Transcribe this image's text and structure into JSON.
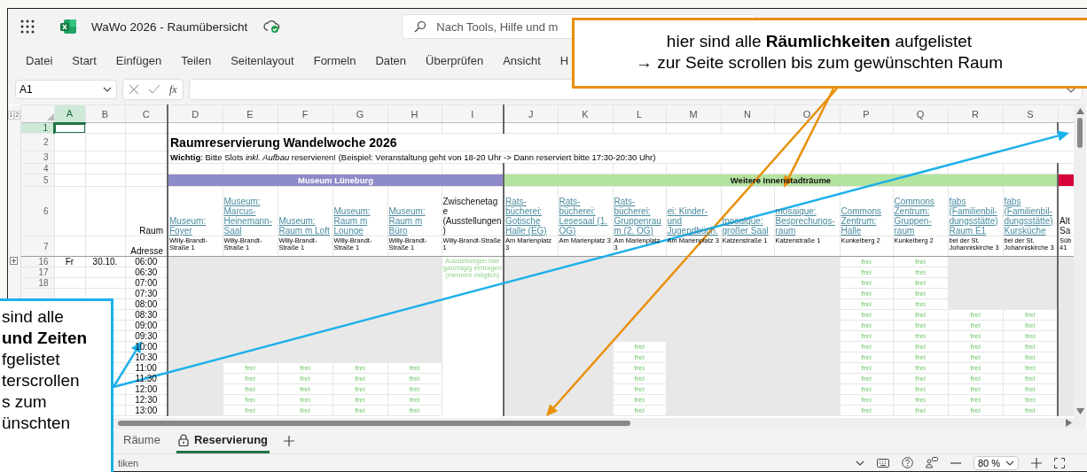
{
  "window": {
    "title": "WaWo 2026 - Raumübersicht",
    "search_placeholder": "Nach Tools, Hilfe und m"
  },
  "menu": [
    {
      "label": "Datei"
    },
    {
      "label": "Start"
    },
    {
      "label": "Einfügen"
    },
    {
      "label": "Teilen"
    },
    {
      "label": "Seitenlayout"
    },
    {
      "label": "Formeln"
    },
    {
      "label": "Daten"
    },
    {
      "label": "Überprüfen"
    },
    {
      "label": "Ansicht"
    },
    {
      "label": "H"
    }
  ],
  "formula_bar": {
    "cell": "A1",
    "function_label": "fx"
  },
  "sheet": {
    "outline_levels": [
      "1",
      "2"
    ],
    "columns": [
      {
        "letter": "A",
        "selected": true
      },
      {
        "letter": "B",
        "selected": false
      },
      {
        "letter": "C",
        "selected": false
      },
      {
        "letter": "D",
        "selected": false
      },
      {
        "letter": "E",
        "selected": false
      },
      {
        "letter": "F",
        "selected": false
      },
      {
        "letter": "G",
        "selected": false
      },
      {
        "letter": "H",
        "selected": false
      },
      {
        "letter": "I",
        "selected": false
      },
      {
        "letter": "J",
        "selected": false
      },
      {
        "letter": "K",
        "selected": false
      },
      {
        "letter": "L",
        "selected": false
      },
      {
        "letter": "M",
        "selected": false
      },
      {
        "letter": "N",
        "selected": false
      },
      {
        "letter": "O",
        "selected": false
      },
      {
        "letter": "P",
        "selected": false
      },
      {
        "letter": "Q",
        "selected": false
      },
      {
        "letter": "R",
        "selected": false
      },
      {
        "letter": "S",
        "selected": false
      }
    ],
    "top_rows": [
      {
        "number": "1",
        "selected": true
      },
      {
        "number": "2",
        "selected": false
      },
      {
        "number": "3",
        "selected": false
      },
      {
        "number": "4",
        "selected": false
      },
      {
        "number": "5",
        "selected": false
      },
      {
        "number": "6",
        "selected": false
      },
      {
        "number": "7",
        "selected": false
      }
    ],
    "title": "Raumreservierung Wandelwoche 2026",
    "note": "**Wichtig**: Bitte Slots *inkl. Aufbau* reservieren! (Beispiel: Veranstaltung geht von 18-20 Uhr -> Dann reserviert bitte 17:30-20:30 Uhr)",
    "room_label": "Raum",
    "address_label": "Adresse"
  },
  "times": [
    {
      "row_number": "16",
      "day": "Fr",
      "date": "30.10.",
      "time": "06:00"
    },
    {
      "row_number": "17",
      "time": "06:30"
    },
    {
      "row_number": "18",
      "time": "07:00"
    },
    {
      "time": "07:30"
    },
    {
      "time": "08:00"
    },
    {
      "time": "08:30"
    },
    {
      "time": "09:00"
    },
    {
      "time": "09:30"
    },
    {
      "time": "10:00"
    },
    {
      "time": "10:30"
    },
    {
      "time": "11:00"
    },
    {
      "time": "11:30"
    },
    {
      "time": "12:00"
    },
    {
      "time": "12:30"
    },
    {
      "time": "13:00"
    }
  ],
  "groups": [
    {
      "name": "Museum Lüneburg",
      "color": "#8e8cc8",
      "rooms": [
        {
          "kind": "bookable",
          "link": true,
          "name": "Museum: Foyer",
          "address": "Willy-Brandt-Straße 1",
          "slots": [
            {
              "free": false
            },
            {
              "free": false
            },
            {
              "free": false
            },
            {
              "free": false
            },
            {
              "free": false
            },
            {
              "free": false
            },
            {
              "free": false
            },
            {
              "free": false
            },
            {
              "free": false
            },
            {
              "free": false
            },
            {
              "free": false
            },
            {
              "free": false
            },
            {
              "free": false
            },
            {
              "free": false
            },
            {
              "free": false
            }
          ]
        },
        {
          "kind": "bookable",
          "link": true,
          "name": "Museum: Marcus-Heinemann-Saal",
          "address": "Willy-Brandt-Straße 1",
          "slots": [
            {
              "free": false
            },
            {
              "free": false
            },
            {
              "free": false
            },
            {
              "free": false
            },
            {
              "free": false
            },
            {
              "free": false
            },
            {
              "free": false
            },
            {
              "free": false
            },
            {
              "free": false
            },
            {
              "free": false
            },
            {
              "free": true,
              "text": "frei"
            },
            {
              "free": true,
              "text": "frei"
            },
            {
              "free": true,
              "text": "frei"
            },
            {
              "free": true,
              "text": "frei"
            },
            {
              "free": true,
              "text": "frei"
            }
          ]
        },
        {
          "kind": "bookable",
          "link": true,
          "name": "Museum: Raum m Loft",
          "address": "Willy-Brandt-Straße 1",
          "slots": [
            {
              "free": false
            },
            {
              "free": false
            },
            {
              "free": false
            },
            {
              "free": false
            },
            {
              "free": false
            },
            {
              "free": false
            },
            {
              "free": false
            },
            {
              "free": false
            },
            {
              "free": false
            },
            {
              "free": false
            },
            {
              "free": true,
              "text": "frei"
            },
            {
              "free": true,
              "text": "frei"
            },
            {
              "free": true,
              "text": "frei"
            },
            {
              "free": true,
              "text": "frei"
            },
            {
              "free": true,
              "text": "frei"
            }
          ]
        },
        {
          "kind": "bookable",
          "link": true,
          "name": "Museum: Raum m Lounge",
          "address": "Willy-Brandt-Straße 1",
          "slots": [
            {
              "free": false
            },
            {
              "free": false
            },
            {
              "free": false
            },
            {
              "free": false
            },
            {
              "free": false
            },
            {
              "free": false
            },
            {
              "free": false
            },
            {
              "free": false
            },
            {
              "free": false
            },
            {
              "free": false
            },
            {
              "free": true,
              "text": "frei"
            },
            {
              "free": true,
              "text": "frei"
            },
            {
              "free": true,
              "text": "frei"
            },
            {
              "free": true,
              "text": "frei"
            },
            {
              "free": true,
              "text": "frei"
            }
          ]
        },
        {
          "kind": "bookable",
          "link": true,
          "name": "Museum: Raum m Büro",
          "address": "Willy-Brandt-Straße 1",
          "slots": [
            {
              "free": false
            },
            {
              "free": false
            },
            {
              "free": false
            },
            {
              "free": false
            },
            {
              "free": false
            },
            {
              "free": false
            },
            {
              "free": false
            },
            {
              "free": false
            },
            {
              "free": false
            },
            {
              "free": false
            },
            {
              "free": true,
              "text": "frei"
            },
            {
              "free": true,
              "text": "frei"
            },
            {
              "free": true,
              "text": "frei"
            },
            {
              "free": true,
              "text": "frei"
            },
            {
              "free": true,
              "text": "frei"
            }
          ]
        },
        {
          "kind": "note",
          "link": false,
          "name": "Zwischenetage (Ausstellungen)",
          "address": "Willy-Brandt-Straße 1",
          "note": "Ausstellungen hier ganztägig eintragen (mehrere möglich)"
        }
      ]
    },
    {
      "name": "Weitere Innenstadträume",
      "color": "#b4e3a0",
      "rooms": [
        {
          "kind": "bookable",
          "link": true,
          "name": "Rats-bücherei: Gotische Halle (EG)",
          "address": "Am Marienplatz 3",
          "slots": [
            {
              "free": false
            },
            {
              "free": false
            },
            {
              "free": false
            },
            {
              "free": false
            },
            {
              "free": false
            },
            {
              "free": false
            },
            {
              "free": false
            },
            {
              "free": false
            },
            {
              "free": false
            },
            {
              "free": false
            },
            {
              "free": false
            },
            {
              "free": false
            },
            {
              "free": false
            },
            {
              "free": false
            },
            {
              "free": false
            }
          ]
        },
        {
          "kind": "bookable",
          "link": true,
          "name": "Rats-bücherei: Lesesaal (1. OG)",
          "address": "Am Marienplatz 3",
          "slots": [
            {
              "free": false
            },
            {
              "free": false
            },
            {
              "free": false
            },
            {
              "free": false
            },
            {
              "free": false
            },
            {
              "free": false
            },
            {
              "free": false
            },
            {
              "free": false
            },
            {
              "free": false
            },
            {
              "free": false
            },
            {
              "free": false
            },
            {
              "free": false
            },
            {
              "free": false
            },
            {
              "free": false
            },
            {
              "free": false
            }
          ]
        },
        {
          "kind": "bookable",
          "link": true,
          "name": "Rats-bücherei: Gruppenraum (2. OG)",
          "address": "Am Marienplatz 3",
          "slots": [
            {
              "free": false
            },
            {
              "free": false
            },
            {
              "free": false
            },
            {
              "free": false
            },
            {
              "free": false
            },
            {
              "free": false
            },
            {
              "free": false
            },
            {
              "free": false
            },
            {
              "free": true,
              "text": "frei"
            },
            {
              "free": true,
              "text": "frei"
            },
            {
              "free": true,
              "text": "frei"
            },
            {
              "free": true,
              "text": "frei"
            },
            {
              "free": true,
              "text": "frei"
            },
            {
              "free": true,
              "text": "frei"
            },
            {
              "free": true,
              "text": "frei"
            }
          ]
        },
        {
          "kind": "bookable",
          "link": true,
          "name": "ei: Kinder- und Jugendbüch.",
          "address": "Am Marienplatz 3",
          "slots": [
            {
              "free": false
            },
            {
              "free": false
            },
            {
              "free": false
            },
            {
              "free": false
            },
            {
              "free": false
            },
            {
              "free": false
            },
            {
              "free": false
            },
            {
              "free": false
            },
            {
              "free": false
            },
            {
              "free": false
            },
            {
              "free": false
            },
            {
              "free": false
            },
            {
              "free": false
            },
            {
              "free": false
            },
            {
              "free": false
            }
          ]
        },
        {
          "kind": "bookable",
          "link": true,
          "name": "mosaique: großer Saal",
          "address": "Katzenstraße 1",
          "slots": [
            {
              "free": false
            },
            {
              "free": false
            },
            {
              "free": false
            },
            {
              "free": false
            },
            {
              "free": false
            },
            {
              "free": false
            },
            {
              "free": false
            },
            {
              "free": false
            },
            {
              "free": false
            },
            {
              "free": false
            },
            {
              "free": false
            },
            {
              "free": false
            },
            {
              "free": false
            },
            {
              "free": false
            },
            {
              "free": false
            }
          ]
        },
        {
          "kind": "bookable",
          "link": true,
          "name": "mosaique: Besprechungs-raum",
          "address": "Katzenstraße 1",
          "slots": [
            {
              "free": false
            },
            {
              "free": false
            },
            {
              "free": false
            },
            {
              "free": false
            },
            {
              "free": false
            },
            {
              "free": false
            },
            {
              "free": false
            },
            {
              "free": false
            },
            {
              "free": false
            },
            {
              "free": false
            },
            {
              "free": false
            },
            {
              "free": false
            },
            {
              "free": false
            },
            {
              "free": false
            },
            {
              "free": false
            }
          ]
        },
        {
          "kind": "bookable",
          "link": true,
          "name": "Commons Zentrum: Halle",
          "address": "Kunkelberg 2",
          "slots": [
            {
              "free": true,
              "text": "frei"
            },
            {
              "free": true,
              "text": "frei"
            },
            {
              "free": true,
              "text": "frei"
            },
            {
              "free": true,
              "text": "frei"
            },
            {
              "free": true,
              "text": "frei"
            },
            {
              "free": true,
              "text": "frei"
            },
            {
              "free": true,
              "text": "frei"
            },
            {
              "free": true,
              "text": "frei"
            },
            {
              "free": true,
              "text": "frei"
            },
            {
              "free": true,
              "text": "frei"
            },
            {
              "free": true,
              "text": "frei"
            },
            {
              "free": true,
              "text": "frei"
            },
            {
              "free": true,
              "text": "frei"
            },
            {
              "free": true,
              "text": "frei"
            },
            {
              "free": true,
              "text": "frei"
            }
          ]
        },
        {
          "kind": "bookable",
          "link": true,
          "name": "Commons Zentrum: Gruppen-raum",
          "address": "Kunkelberg 2",
          "slots": [
            {
              "free": true,
              "text": "frei"
            },
            {
              "free": true,
              "text": "frei"
            },
            {
              "free": true,
              "text": "frei"
            },
            {
              "free": true,
              "text": "frei"
            },
            {
              "free": true,
              "text": "frei"
            },
            {
              "free": true,
              "text": "frei"
            },
            {
              "free": true,
              "text": "frei"
            },
            {
              "free": true,
              "text": "frei"
            },
            {
              "free": true,
              "text": "frei"
            },
            {
              "free": true,
              "text": "frei"
            },
            {
              "free": true,
              "text": "frei"
            },
            {
              "free": true,
              "text": "frei"
            },
            {
              "free": true,
              "text": "frei"
            },
            {
              "free": true,
              "text": "frei"
            },
            {
              "free": true,
              "text": "frei"
            }
          ]
        },
        {
          "kind": "bookable",
          "link": true,
          "name": "fabs (Familienbil-dungsstätte) Raum E1",
          "address": "bei der St. Johanniskirche 3",
          "slots": [
            {
              "free": false
            },
            {
              "free": false
            },
            {
              "free": false
            },
            {
              "free": false
            },
            {
              "free": false
            },
            {
              "free": true,
              "text": "frei"
            },
            {
              "free": true,
              "text": "frei"
            },
            {
              "free": true,
              "text": "frei"
            },
            {
              "free": true,
              "text": "frei"
            },
            {
              "free": true,
              "text": "frei"
            },
            {
              "free": true,
              "text": "frei"
            },
            {
              "free": true,
              "text": "frei"
            },
            {
              "free": true,
              "text": "frei"
            },
            {
              "free": true,
              "text": "frei"
            },
            {
              "free": true,
              "text": "frei"
            }
          ]
        },
        {
          "kind": "bookable",
          "link": true,
          "name": "fabs (Familienbil-dungsstätte) Kursküche",
          "address": "bei der St. Johanniskirche 3",
          "slots": [
            {
              "free": false
            },
            {
              "free": false
            },
            {
              "free": false
            },
            {
              "free": false
            },
            {
              "free": false
            },
            {
              "free": true,
              "text": "frei"
            },
            {
              "free": true,
              "text": "frei"
            },
            {
              "free": true,
              "text": "frei"
            },
            {
              "free": true,
              "text": "frei"
            },
            {
              "free": true,
              "text": "frei"
            },
            {
              "free": true,
              "text": "frei"
            },
            {
              "free": true,
              "text": "frei"
            },
            {
              "free": true,
              "text": "frei"
            },
            {
              "free": true,
              "text": "frei"
            },
            {
              "free": true,
              "text": "frei"
            }
          ]
        }
      ]
    },
    {
      "color": "#d6003a",
      "rooms": [
        {
          "kind": "bookable",
          "link": false,
          "name": "Alt Sa",
          "address": "Süb 41",
          "slots": [
            {
              "free": false
            },
            {
              "free": false
            },
            {
              "free": false
            },
            {
              "free": false
            },
            {
              "free": false
            },
            {
              "free": false
            },
            {
              "free": false
            },
            {
              "free": false
            },
            {
              "free": false
            },
            {
              "free": false
            },
            {
              "free": false
            },
            {
              "free": false
            },
            {
              "free": false
            },
            {
              "free": false
            },
            {
              "free": false
            }
          ]
        }
      ]
    }
  ],
  "sheet_tabs": [
    {
      "label": "Räume",
      "selected": false,
      "locked": false
    },
    {
      "label": "Reservierung",
      "selected": true,
      "locked": true
    }
  ],
  "status_bar": {
    "text": "tiken",
    "zoom": "80 %"
  },
  "callouts": [
    {
      "kind": "rooms",
      "lines": [
        "hier sind alle **Räumlichkeiten** aufgelistet",
        "→ zur Seite scrollen bis zum gewünschten Raum"
      ]
    },
    {
      "kind": "times",
      "lines": [
        "sind alle",
        "**und Zeiten**",
        "fgelistet",
        "terscrollen",
        "s zum",
        "ünschten"
      ]
    }
  ]
}
